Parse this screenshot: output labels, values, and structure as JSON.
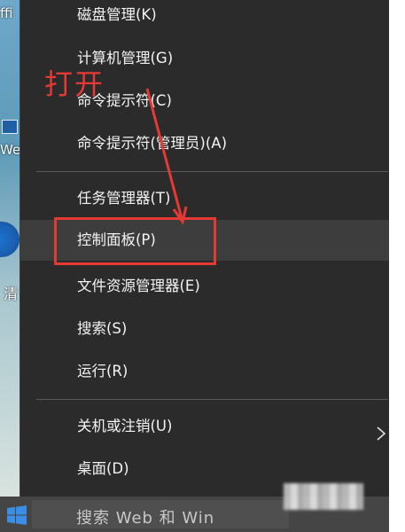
{
  "desktop": {
    "fragment_1": "ffi",
    "fragment_2": "We",
    "fragment_3": "清"
  },
  "menu": {
    "items": [
      {
        "label": "磁盘管理(K)"
      },
      {
        "label": "计算机管理(G)"
      },
      {
        "label": "命令提示符(C)"
      },
      {
        "label": "命令提示符(管理员)(A)"
      },
      {
        "label": "任务管理器(T)"
      },
      {
        "label": "控制面板(P)"
      },
      {
        "label": "文件资源管理器(E)"
      },
      {
        "label": "搜索(S)"
      },
      {
        "label": "运行(R)"
      },
      {
        "label": "关机或注销(U)"
      },
      {
        "label": "桌面(D)"
      }
    ]
  },
  "annotation": {
    "text": "打开",
    "color": "#e53935"
  },
  "taskbar": {
    "search_text": "搜索 Web 和 Win"
  },
  "colors": {
    "menu_bg": "#2b2b2b",
    "highlight_bg": "#3d3d3d",
    "text": "#f2f2f2"
  }
}
